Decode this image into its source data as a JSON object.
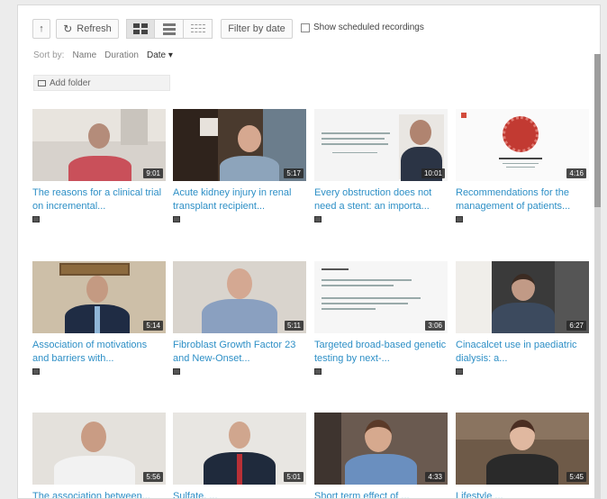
{
  "toolbar": {
    "up_icon": "up-arrow-icon",
    "refresh_label": "Refresh",
    "refresh_icon": "refresh-icon",
    "view_modes": [
      "grid-view-icon",
      "list-view-icon",
      "details-view-icon"
    ],
    "filter_label": "Filter by date",
    "scheduled_label": "Show scheduled recordings"
  },
  "sort": {
    "prefix": "Sort by:",
    "options": [
      "Name",
      "Duration",
      "Date ▾"
    ],
    "active": "Date"
  },
  "add_folder_label": "Add folder",
  "videos": [
    {
      "title": "The reasons for a clinical trial on incremental...",
      "duration": "9:01"
    },
    {
      "title": "Acute kidney injury in renal transplant recipient...",
      "duration": "5:17"
    },
    {
      "title": "Every obstruction does not need a stent: an importa...",
      "duration": "10:01"
    },
    {
      "title": "Recommendations for the management of patients...",
      "duration": "4:16"
    },
    {
      "title": "Association of motivations and barriers with...",
      "duration": "5:14"
    },
    {
      "title": "Fibroblast Growth Factor 23 and New-Onset...",
      "duration": "5:11"
    },
    {
      "title": "Targeted broad-based genetic testing by next-...",
      "duration": "3:06"
    },
    {
      "title": "Cinacalcet use in paediatric dialysis: a...",
      "duration": "6:27"
    },
    {
      "title": "The association between...",
      "duration": "5:56"
    },
    {
      "title": "Sulfate, ...",
      "duration": "5:01"
    },
    {
      "title": "Short term effect of ...",
      "duration": "4:33"
    },
    {
      "title": "Lifestyle ...",
      "duration": "5:45"
    }
  ],
  "colors": {
    "link": "#2d8fc6",
    "duration_bg": "#282828"
  }
}
